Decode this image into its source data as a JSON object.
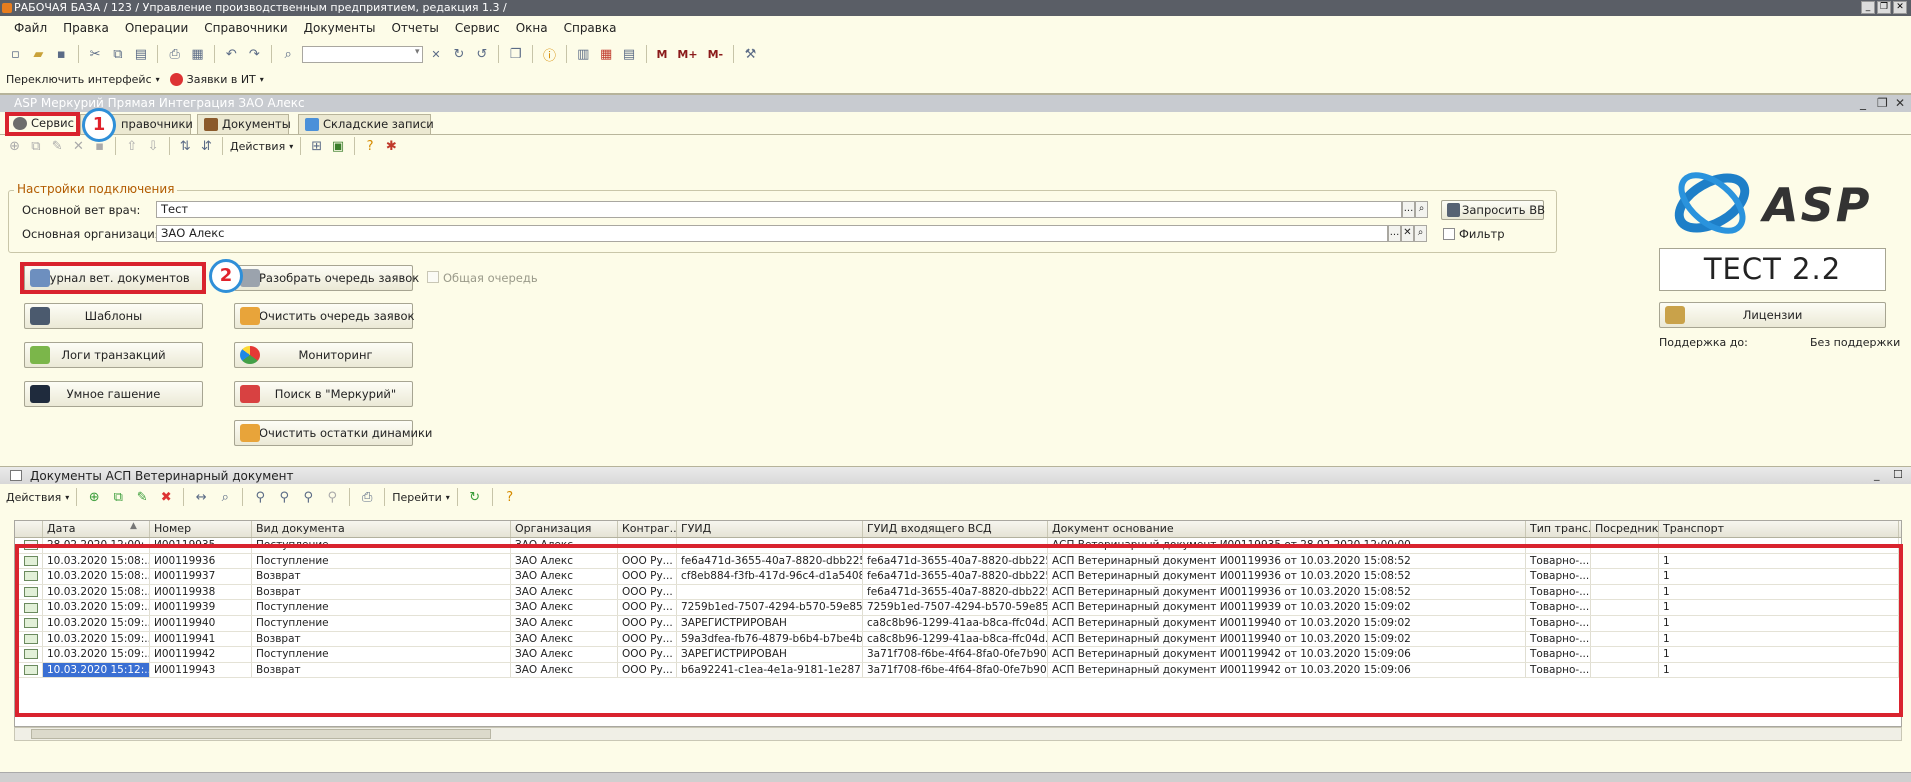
{
  "app_title": "РАБОЧАЯ БАЗА / 123 / Управление производственным предприятием, редакция 1.3 /",
  "menu": [
    "Файл",
    "Правка",
    "Операции",
    "Справочники",
    "Документы",
    "Отчеты",
    "Сервис",
    "Окна",
    "Справка"
  ],
  "toolbar2": {
    "switch_interface": "Переключить интерфейс",
    "requests_it": "Заявки в ИТ"
  },
  "memory_buttons": [
    "M",
    "M+",
    "M-"
  ],
  "window_title": "ASP Меркурий Прямая Интеграция ЗАО Алекс",
  "tabs": [
    "Сервис",
    "Справочники",
    "Документы",
    "Складские записи"
  ],
  "tabs_visible": {
    "spr": "правочники"
  },
  "actions_label": "Действия",
  "connection": {
    "group_title": "Настройки подключения",
    "vet_label": "Основной вет врач:",
    "vet_value": "Тест",
    "org_label": "Основная организация:",
    "org_value": "ЗАО Алекс",
    "request_vv": "Запросить ВВ",
    "filter_label": "Фильтр",
    "dots": "...",
    "clear": "✕"
  },
  "buttons_left": [
    "Журнал вет. документов",
    "Шаблоны",
    "Логи транзакций",
    "Умное гашение"
  ],
  "buttons_right": [
    "Разобрать очередь заявок",
    "Очистить очередь заявок",
    "Мониторинг",
    "Поиск в \"Меркурий\"",
    "Очистить остатки динамики"
  ],
  "common_queue": "Общая очередь",
  "logo_text": "ASP",
  "version": "ТЕСТ 2.2",
  "licenses": "Лицензии",
  "support_label": "Поддержка до:",
  "support_value": "Без поддержки",
  "annotations": [
    "1",
    "2"
  ],
  "list": {
    "title": "Документы АСП Ветеринарный документ",
    "actions": "Действия",
    "goto": "Перейти",
    "columns": [
      "Дата",
      "Номер",
      "Вид документа",
      "Организация",
      "Контраг...",
      "ГУИД",
      "ГУИД входящего ВСД",
      "Документ основание",
      "Тип транс...",
      "Посредник",
      "Транспорт"
    ],
    "rows": [
      [
        "28.02.2020 12:00:...",
        "И00119935",
        "Поступление",
        "ЗАО Алекс",
        "",
        "",
        "",
        "АСП Ветеринарный документ И00119935 от 28.02.2020 12:00:00",
        "",
        "",
        ""
      ],
      [
        "10.03.2020 15:08:...",
        "И00119936",
        "Поступление",
        "ЗАО Алекс",
        "ООО Ру...",
        "fe6a471d-3655-40a7-8820-dbb225...",
        "fe6a471d-3655-40a7-8820-dbb225...",
        "АСП Ветеринарный документ И00119936 от 10.03.2020 15:08:52",
        "Товарно-...",
        "",
        "1"
      ],
      [
        "10.03.2020 15:08:...",
        "И00119937",
        "Возврат",
        "ЗАО Алекс",
        "ООО Ру...",
        "cf8eb884-f3fb-417d-96c4-d1a5408...",
        "fe6a471d-3655-40a7-8820-dbb225...",
        "АСП Ветеринарный документ И00119936 от 10.03.2020 15:08:52",
        "Товарно-...",
        "",
        "1"
      ],
      [
        "10.03.2020 15:08:...",
        "И00119938",
        "Возврат",
        "ЗАО Алекс",
        "ООО Ру...",
        "",
        "fe6a471d-3655-40a7-8820-dbb225...",
        "АСП Ветеринарный документ И00119936 от 10.03.2020 15:08:52",
        "Товарно-...",
        "",
        "1"
      ],
      [
        "10.03.2020 15:09:...",
        "И00119939",
        "Поступление",
        "ЗАО Алекс",
        "ООО Ру...",
        "7259b1ed-7507-4294-b570-59e85...",
        "7259b1ed-7507-4294-b570-59e85...",
        "АСП Ветеринарный документ И00119939 от 10.03.2020 15:09:02",
        "Товарно-...",
        "",
        "1"
      ],
      [
        "10.03.2020 15:09:...",
        "И00119940",
        "Поступление",
        "ЗАО Алекс",
        "ООО Ру...",
        "ЗАРЕГИСТРИРОВАН",
        "ca8c8b96-1299-41aa-b8ca-ffc04d...",
        "АСП Ветеринарный документ И00119940 от 10.03.2020 15:09:02",
        "Товарно-...",
        "",
        "1"
      ],
      [
        "10.03.2020 15:09:...",
        "И00119941",
        "Возврат",
        "ЗАО Алекс",
        "ООО Ру...",
        "59a3dfea-fb76-4879-b6b4-b7be4b...",
        "ca8c8b96-1299-41aa-b8ca-ffc04d...",
        "АСП Ветеринарный документ И00119940 от 10.03.2020 15:09:02",
        "Товарно-...",
        "",
        "1"
      ],
      [
        "10.03.2020 15:09:...",
        "И00119942",
        "Поступление",
        "ЗАО Алекс",
        "ООО Ру...",
        "ЗАРЕГИСТРИРОВАН",
        "3a71f708-f6be-4f64-8fa0-0fe7b902...",
        "АСП Ветеринарный документ И00119942 от 10.03.2020 15:09:06",
        "Товарно-...",
        "",
        "1"
      ],
      [
        "10.03.2020 15:12:...",
        "И00119943",
        "Возврат",
        "ЗАО Алекс",
        "ООО Ру...",
        "b6a92241-c1ea-4e1a-9181-1e287...",
        "3a71f708-f6be-4f64-8fa0-0fe7b902...",
        "АСП Ветеринарный документ И00119942 от 10.03.2020 15:09:06",
        "Товарно-...",
        "",
        "1"
      ]
    ],
    "selected_row": 8
  },
  "colors": {
    "highlight": "#d9232e",
    "circle": "#2f8fd8",
    "selection": "#3a6fd3",
    "logo_blue": "#1e7fc8"
  }
}
